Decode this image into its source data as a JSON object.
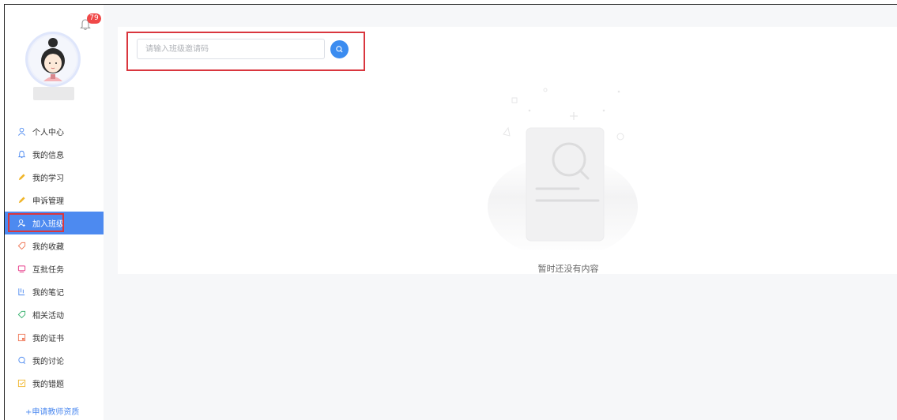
{
  "notifications": {
    "count": "79"
  },
  "sidebar": {
    "items": [
      {
        "label": "个人中心",
        "icon": "user-icon",
        "color": "#4d8af0"
      },
      {
        "label": "我的信息",
        "icon": "bell-icon",
        "color": "#4d8af0"
      },
      {
        "label": "我的学习",
        "icon": "pencil-icon",
        "color": "#f0b52a"
      },
      {
        "label": "申诉管理",
        "icon": "pencil-icon",
        "color": "#f0b52a"
      },
      {
        "label": "加入班级",
        "icon": "add-user-icon",
        "active": true
      },
      {
        "label": "我的收藏",
        "icon": "tag-icon",
        "color": "#f07a5a"
      },
      {
        "label": "互批任务",
        "icon": "monitor-icon",
        "color": "#e8458f"
      },
      {
        "label": "我的笔记",
        "icon": "notes-icon",
        "color": "#4d8af0"
      },
      {
        "label": "相关活动",
        "icon": "tag-icon",
        "color": "#3cb371"
      },
      {
        "label": "我的证书",
        "icon": "certificate-icon",
        "color": "#f07a5a"
      },
      {
        "label": "我的讨论",
        "icon": "chat-icon",
        "color": "#4d8af0"
      },
      {
        "label": "我的错题",
        "icon": "checkbox-icon",
        "color": "#f0b52a"
      }
    ],
    "apply_label": "+申请教师资质"
  },
  "join_class": {
    "placeholder": "请输入班级邀请码",
    "value": ""
  },
  "empty_state": {
    "text": "暂时还没有内容"
  },
  "colors": {
    "accent": "#4d8af0",
    "search_button": "#3b8cf0",
    "highlight": "#d9363e",
    "badge": "#f04848"
  }
}
